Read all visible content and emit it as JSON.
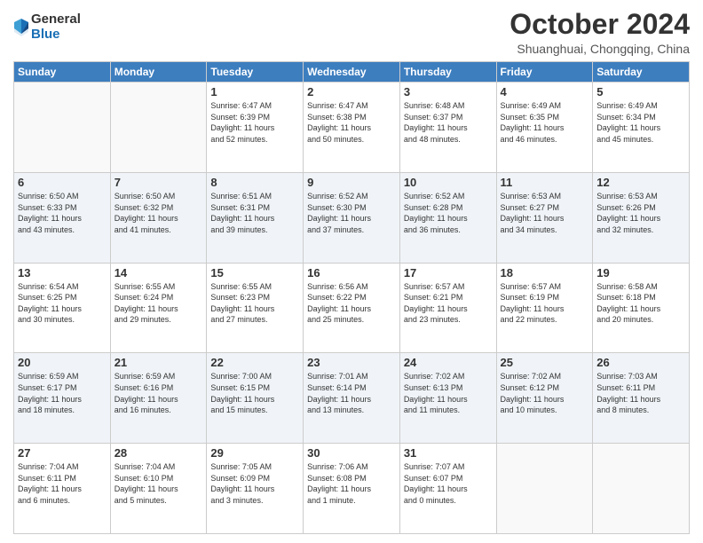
{
  "logo": {
    "general": "General",
    "blue": "Blue"
  },
  "header": {
    "month": "October 2024",
    "location": "Shuanghuai, Chongqing, China"
  },
  "days_of_week": [
    "Sunday",
    "Monday",
    "Tuesday",
    "Wednesday",
    "Thursday",
    "Friday",
    "Saturday"
  ],
  "weeks": [
    [
      {
        "day": "",
        "info": ""
      },
      {
        "day": "",
        "info": ""
      },
      {
        "day": "1",
        "info": "Sunrise: 6:47 AM\nSunset: 6:39 PM\nDaylight: 11 hours\nand 52 minutes."
      },
      {
        "day": "2",
        "info": "Sunrise: 6:47 AM\nSunset: 6:38 PM\nDaylight: 11 hours\nand 50 minutes."
      },
      {
        "day": "3",
        "info": "Sunrise: 6:48 AM\nSunset: 6:37 PM\nDaylight: 11 hours\nand 48 minutes."
      },
      {
        "day": "4",
        "info": "Sunrise: 6:49 AM\nSunset: 6:35 PM\nDaylight: 11 hours\nand 46 minutes."
      },
      {
        "day": "5",
        "info": "Sunrise: 6:49 AM\nSunset: 6:34 PM\nDaylight: 11 hours\nand 45 minutes."
      }
    ],
    [
      {
        "day": "6",
        "info": "Sunrise: 6:50 AM\nSunset: 6:33 PM\nDaylight: 11 hours\nand 43 minutes."
      },
      {
        "day": "7",
        "info": "Sunrise: 6:50 AM\nSunset: 6:32 PM\nDaylight: 11 hours\nand 41 minutes."
      },
      {
        "day": "8",
        "info": "Sunrise: 6:51 AM\nSunset: 6:31 PM\nDaylight: 11 hours\nand 39 minutes."
      },
      {
        "day": "9",
        "info": "Sunrise: 6:52 AM\nSunset: 6:30 PM\nDaylight: 11 hours\nand 37 minutes."
      },
      {
        "day": "10",
        "info": "Sunrise: 6:52 AM\nSunset: 6:28 PM\nDaylight: 11 hours\nand 36 minutes."
      },
      {
        "day": "11",
        "info": "Sunrise: 6:53 AM\nSunset: 6:27 PM\nDaylight: 11 hours\nand 34 minutes."
      },
      {
        "day": "12",
        "info": "Sunrise: 6:53 AM\nSunset: 6:26 PM\nDaylight: 11 hours\nand 32 minutes."
      }
    ],
    [
      {
        "day": "13",
        "info": "Sunrise: 6:54 AM\nSunset: 6:25 PM\nDaylight: 11 hours\nand 30 minutes."
      },
      {
        "day": "14",
        "info": "Sunrise: 6:55 AM\nSunset: 6:24 PM\nDaylight: 11 hours\nand 29 minutes."
      },
      {
        "day": "15",
        "info": "Sunrise: 6:55 AM\nSunset: 6:23 PM\nDaylight: 11 hours\nand 27 minutes."
      },
      {
        "day": "16",
        "info": "Sunrise: 6:56 AM\nSunset: 6:22 PM\nDaylight: 11 hours\nand 25 minutes."
      },
      {
        "day": "17",
        "info": "Sunrise: 6:57 AM\nSunset: 6:21 PM\nDaylight: 11 hours\nand 23 minutes."
      },
      {
        "day": "18",
        "info": "Sunrise: 6:57 AM\nSunset: 6:19 PM\nDaylight: 11 hours\nand 22 minutes."
      },
      {
        "day": "19",
        "info": "Sunrise: 6:58 AM\nSunset: 6:18 PM\nDaylight: 11 hours\nand 20 minutes."
      }
    ],
    [
      {
        "day": "20",
        "info": "Sunrise: 6:59 AM\nSunset: 6:17 PM\nDaylight: 11 hours\nand 18 minutes."
      },
      {
        "day": "21",
        "info": "Sunrise: 6:59 AM\nSunset: 6:16 PM\nDaylight: 11 hours\nand 16 minutes."
      },
      {
        "day": "22",
        "info": "Sunrise: 7:00 AM\nSunset: 6:15 PM\nDaylight: 11 hours\nand 15 minutes."
      },
      {
        "day": "23",
        "info": "Sunrise: 7:01 AM\nSunset: 6:14 PM\nDaylight: 11 hours\nand 13 minutes."
      },
      {
        "day": "24",
        "info": "Sunrise: 7:02 AM\nSunset: 6:13 PM\nDaylight: 11 hours\nand 11 minutes."
      },
      {
        "day": "25",
        "info": "Sunrise: 7:02 AM\nSunset: 6:12 PM\nDaylight: 11 hours\nand 10 minutes."
      },
      {
        "day": "26",
        "info": "Sunrise: 7:03 AM\nSunset: 6:11 PM\nDaylight: 11 hours\nand 8 minutes."
      }
    ],
    [
      {
        "day": "27",
        "info": "Sunrise: 7:04 AM\nSunset: 6:11 PM\nDaylight: 11 hours\nand 6 minutes."
      },
      {
        "day": "28",
        "info": "Sunrise: 7:04 AM\nSunset: 6:10 PM\nDaylight: 11 hours\nand 5 minutes."
      },
      {
        "day": "29",
        "info": "Sunrise: 7:05 AM\nSunset: 6:09 PM\nDaylight: 11 hours\nand 3 minutes."
      },
      {
        "day": "30",
        "info": "Sunrise: 7:06 AM\nSunset: 6:08 PM\nDaylight: 11 hours\nand 1 minute."
      },
      {
        "day": "31",
        "info": "Sunrise: 7:07 AM\nSunset: 6:07 PM\nDaylight: 11 hours\nand 0 minutes."
      },
      {
        "day": "",
        "info": ""
      },
      {
        "day": "",
        "info": ""
      }
    ]
  ]
}
